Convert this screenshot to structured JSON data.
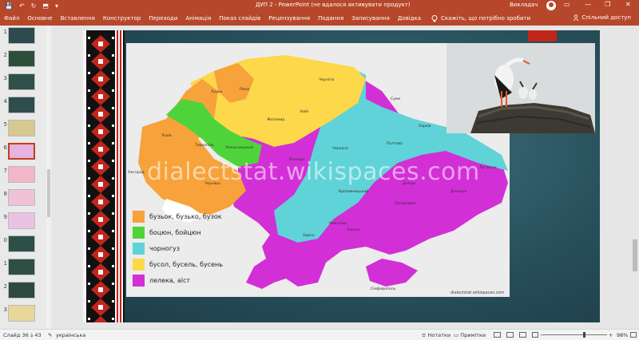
{
  "titlebar": {
    "title": "ДУП 2  -  PowerPoint (не вдалося активувати продукт)",
    "user": "Викладач",
    "qat": [
      "💾",
      "↶",
      "↻",
      "⬒",
      "▾"
    ],
    "window_buttons": [
      "—",
      "❐",
      "✕",
      "▭"
    ]
  },
  "ribbon": {
    "tabs": [
      "Файл",
      "Основне",
      "Вставлення",
      "Конструктор",
      "Переходи",
      "Анімація",
      "Показ слайдів",
      "Рецензування",
      "Подання",
      "Записування",
      "Довідка"
    ],
    "tell_me": "Скажіть, що потрібно зробити",
    "share": "Спільний доступ"
  },
  "thumbnails": {
    "numbers": [
      "1",
      "2",
      "3",
      "4",
      "5",
      "6",
      "7",
      "8",
      "9",
      "0",
      "1",
      "2",
      "3"
    ],
    "selected_index": 5
  },
  "slide": {
    "watermark": "dialectstat.wikispaces.com",
    "credit": "dialectstat.wikispaces.com",
    "legend": [
      {
        "label": "бузьок, бузько, бузок",
        "color": "#f7a23a"
      },
      {
        "label": "боцюн, бойцюн",
        "color": "#4fd33a"
      },
      {
        "label": "чорногуз",
        "color": "#5fd3d8"
      },
      {
        "label": "бусол, бусель, бусень",
        "color": "#fcd84a"
      },
      {
        "label": "лелека, аїст",
        "color": "#d22fd6"
      }
    ],
    "cities": [
      "Луцьк",
      "Рівне",
      "Житомир",
      "Чернігів",
      "Київ",
      "Суми",
      "Харків",
      "Полтава",
      "Черкаси",
      "Вінниця",
      "Львів",
      "Тернопіль",
      "Хмельницький",
      "Ужгород",
      "Чернівці",
      "Луганськ",
      "Донецьк",
      "Дніпро",
      "Запоріжжя",
      "Херсон",
      "Одеса",
      "Миколаїв",
      "Кропивницький",
      "Сімферополь"
    ],
    "colors": {
      "ornament_red": "#c0261c",
      "ornament_black": "#111111",
      "bg": "#274f5b"
    }
  },
  "status": {
    "slide": "Слайд 36 з 43",
    "lang": "українська",
    "notes": "Нотатки",
    "comments": "Примітки",
    "zoom": "98%"
  }
}
